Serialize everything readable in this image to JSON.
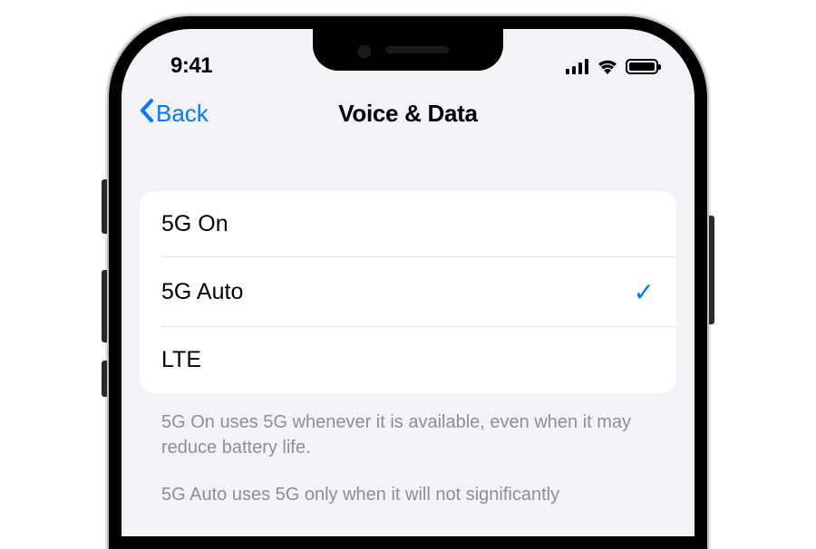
{
  "status": {
    "time": "9:41"
  },
  "nav": {
    "back_label": "Back",
    "title": "Voice & Data"
  },
  "options": [
    {
      "label": "5G On",
      "selected": false
    },
    {
      "label": "5G Auto",
      "selected": true
    },
    {
      "label": "LTE",
      "selected": false
    }
  ],
  "footer": {
    "text1": "5G On uses 5G whenever it is available, even when it may reduce battery life.",
    "text2": "5G Auto uses 5G only when it will not significantly"
  },
  "checkmark_glyph": "✓"
}
